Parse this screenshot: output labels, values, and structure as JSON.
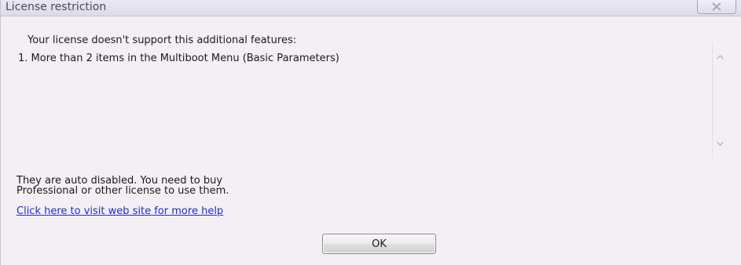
{
  "window": {
    "title": "License restriction",
    "close_icon": "close-icon"
  },
  "message": {
    "header": "Your license doesn't support this additional features:",
    "features": [
      "1. More than 2 items in the Multiboot Menu (Basic Parameters)"
    ]
  },
  "scrollbar": {
    "up_icon": "scroll-up-arrow-icon",
    "down_icon": "scroll-down-arrow-icon"
  },
  "info": {
    "line1": "They are auto disabled. You need to buy",
    "line2": "Professional or other license to use them."
  },
  "help_link": {
    "text": "Click here to visit web site for more help"
  },
  "buttons": {
    "ok_label": "OK"
  },
  "colors": {
    "dialog_background": "#f4eff4",
    "link": "#1c2fc7",
    "title_bar": "#dcdbe9"
  }
}
